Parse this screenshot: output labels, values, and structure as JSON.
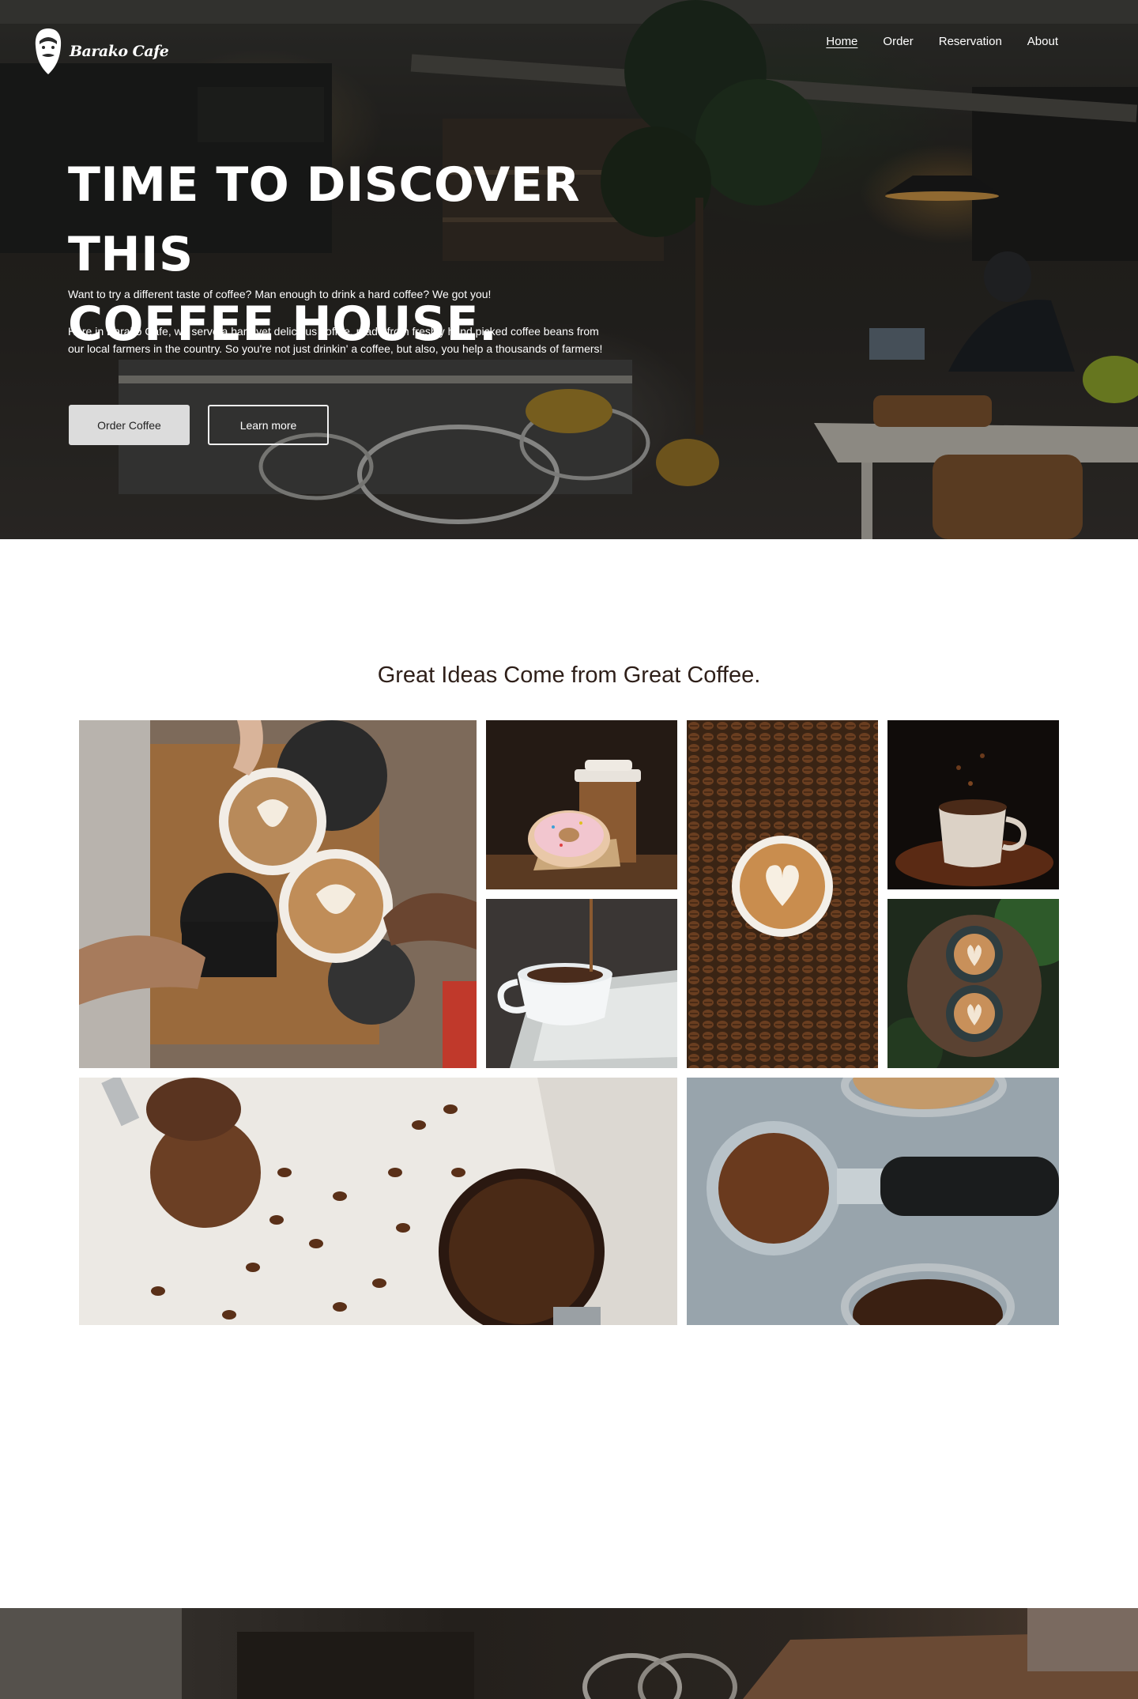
{
  "brand": {
    "name": "Barako Cafe",
    "logo_icon": "bearded-man-icon"
  },
  "nav": {
    "items": [
      {
        "label": "Home",
        "active": true
      },
      {
        "label": "Order",
        "active": false
      },
      {
        "label": "Reservation",
        "active": false
      },
      {
        "label": "About",
        "active": false
      }
    ]
  },
  "hero": {
    "title_line1": "TIME TO DISCOVER THIS",
    "title_line2": "COFFEE HOUSE.",
    "tagline": "Want to try a different taste of coffee? Man enough to drink a hard coffee? We got you!",
    "description": "Here in Barako Cafe, we serve a hard yet delicious coffee, made from freshly hand picked coffee beans from our local farmers in the country. So you're not just drinkin' a coffee, but also, you help a thousands of farmers!",
    "primary_button": "Order Coffee",
    "secondary_button": "Learn more"
  },
  "gallery": {
    "heading": "Great Ideas Come from Great Coffee.",
    "images": [
      "cheers-lattes-photo",
      "donut-and-coffee-cup-photo",
      "latte-on-coffee-beans-photo",
      "cup-on-roasted-beans-photo",
      "pouring-espresso-photo",
      "two-lattes-on-stump-photo",
      "ground-coffee-spoon-and-beans-photo",
      "portafilter-with-grounds-photo"
    ]
  },
  "colors": {
    "hero_overlay": "#1a1a1a",
    "heading_text": "#2e1f19",
    "primary_button_bg": "#dcdcdc",
    "white": "#ffffff"
  }
}
